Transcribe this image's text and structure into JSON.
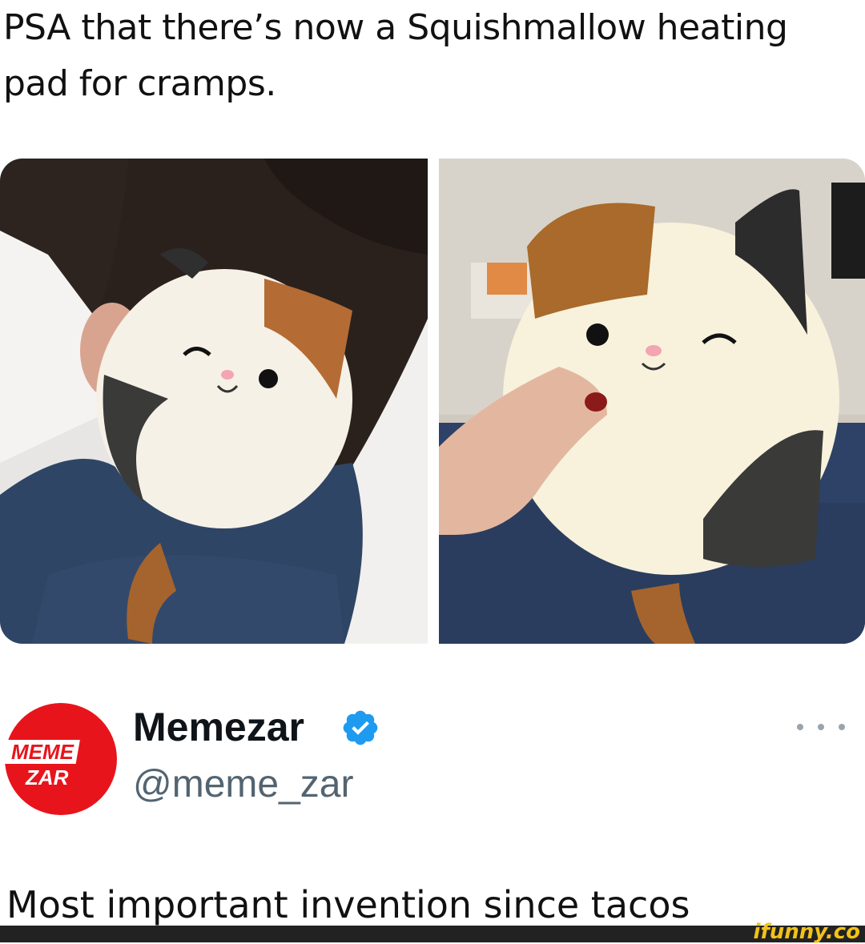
{
  "meme": {
    "caption": "PSA that there’s now a Squishmallow heating pad for cramps."
  },
  "tweet": {
    "display_name": "Memezar",
    "handle": "@meme_zar",
    "text": "Most important invention since tacos",
    "avatar_logo_text": [
      "MEME",
      "ZAR"
    ]
  },
  "watermark": "ifunny.co",
  "colors": {
    "avatar_red": "#e8141c",
    "verified_blue": "#1d9bf0",
    "watermark_yellow": "#f2c218"
  },
  "icons": {
    "verified": "verified-badge-icon",
    "more": "more-options-icon"
  }
}
